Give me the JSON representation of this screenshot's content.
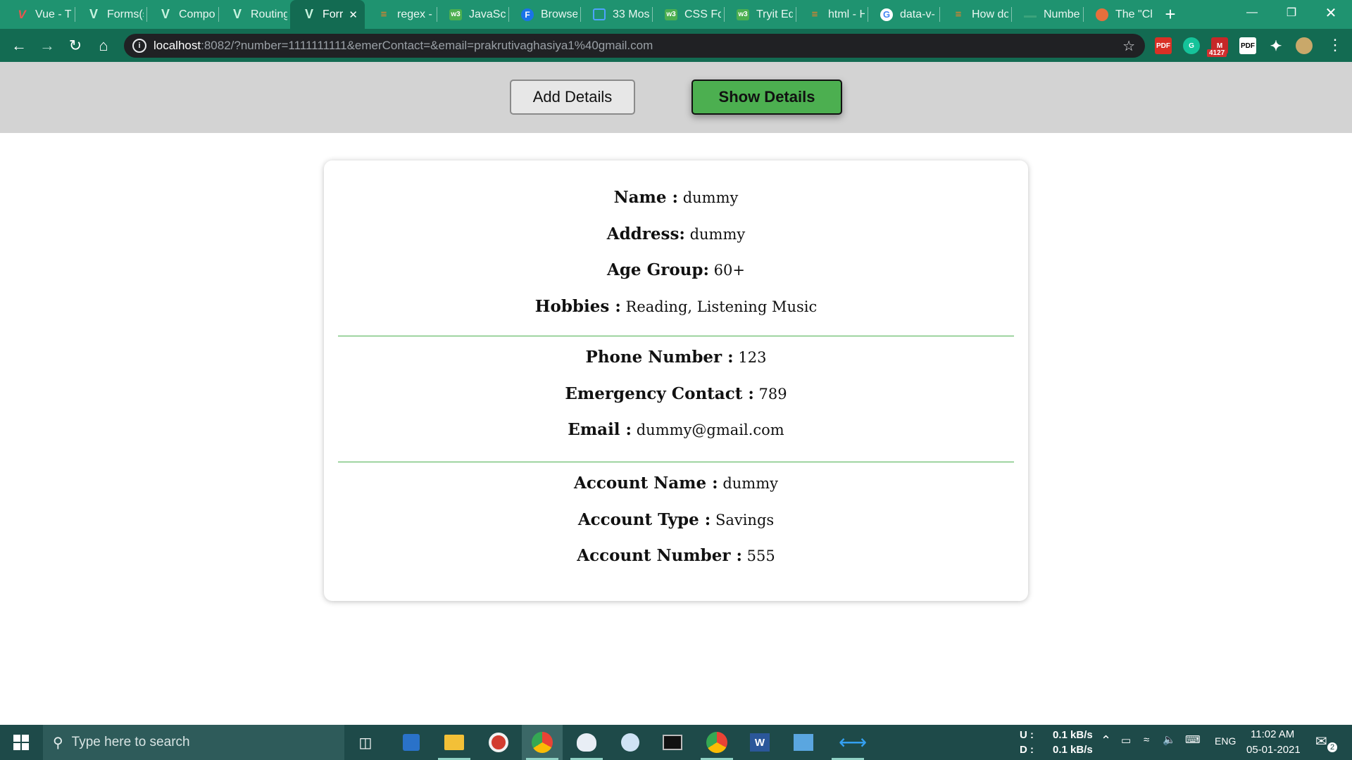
{
  "browser": {
    "tabs": [
      {
        "title": "Vue - Tl",
        "icon": "vue-red-icon",
        "active": false
      },
      {
        "title": "Forms(s",
        "icon": "vue-icon",
        "active": false
      },
      {
        "title": "Compo",
        "icon": "vue-icon",
        "active": false
      },
      {
        "title": "Routing",
        "icon": "vue-icon",
        "active": false
      },
      {
        "title": "Forr",
        "icon": "vue-icon",
        "active": true
      },
      {
        "title": "regex -",
        "icon": "stackoverflow-icon",
        "active": false
      },
      {
        "title": "JavaScri",
        "icon": "w3schools-icon",
        "active": false
      },
      {
        "title": "Browse",
        "icon": "f-icon",
        "active": false
      },
      {
        "title": "33 Mos",
        "icon": "doc-icon",
        "active": false
      },
      {
        "title": "CSS For",
        "icon": "w3schools-icon",
        "active": false
      },
      {
        "title": "Tryit Ed",
        "icon": "w3schools-icon",
        "active": false
      },
      {
        "title": "html - H",
        "icon": "stackoverflow-icon",
        "active": false
      },
      {
        "title": "data-v-",
        "icon": "google-icon",
        "active": false
      },
      {
        "title": "How do",
        "icon": "stackoverflow-icon",
        "active": false
      },
      {
        "title": "Numbe",
        "icon": "underline-icon",
        "active": false
      },
      {
        "title": "The \"Ch",
        "icon": "chrome-icon",
        "active": false
      }
    ],
    "url_host": "localhost",
    "url_rest": ":8082/?number=1111111111&emerContact=&email=prakrutivaghasiya1%40gmail.com",
    "ext_badge": "4127"
  },
  "nav": {
    "add_label": "Add Details",
    "show_label": "Show Details"
  },
  "details": {
    "personal": [
      {
        "label": "Name :",
        "value": "dummy"
      },
      {
        "label": "Address:",
        "value": "dummy"
      },
      {
        "label": "Age Group:",
        "value": "60+"
      },
      {
        "label": "Hobbies :",
        "value": "Reading, Listening Music"
      }
    ],
    "contact": [
      {
        "label": "Phone Number :",
        "value": "123"
      },
      {
        "label": "Emergency Contact :",
        "value": "789"
      },
      {
        "label": "Email :",
        "value": "dummy@gmail.com"
      }
    ],
    "account": [
      {
        "label": "Account Name :",
        "value": "dummy"
      },
      {
        "label": "Account Type :",
        "value": "Savings"
      },
      {
        "label": "Account Number :",
        "value": "555"
      }
    ]
  },
  "taskbar": {
    "search_placeholder": "Type here to search",
    "net_up_label": "U :",
    "net_up_value": "0.1 kB/s",
    "net_down_label": "D :",
    "net_down_value": "0.1 kB/s",
    "lang": "ENG",
    "time": "11:02 AM",
    "date": "05-01-2021",
    "notification_count": "2"
  },
  "colors": {
    "accent_green": "#4caf50",
    "browser_frame": "#1f9370",
    "taskbar": "#1e4a49"
  }
}
